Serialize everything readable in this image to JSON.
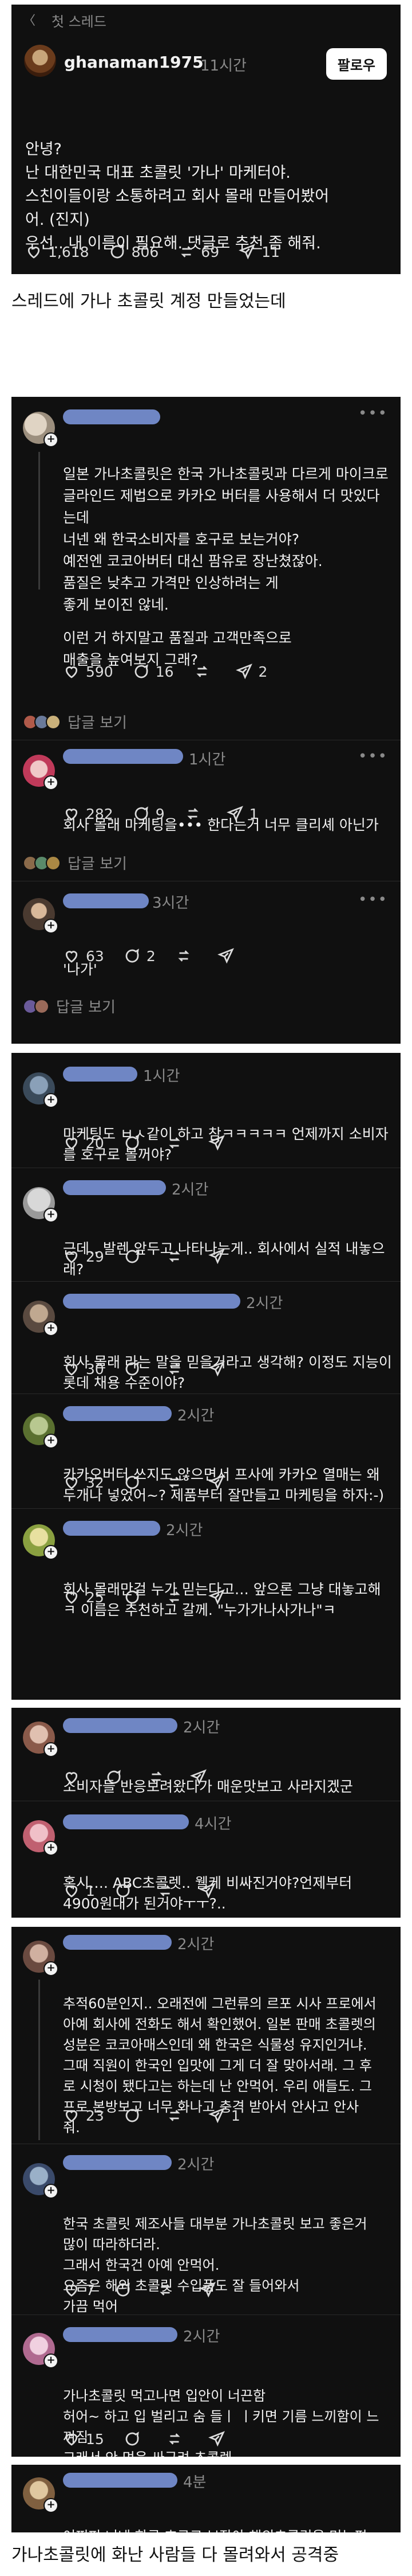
{
  "header": {
    "back_label": "〈",
    "title": "첫 스레드"
  },
  "post": {
    "username": "ghanaman1975",
    "time": "11시간",
    "follow_label": "팔로우",
    "lines": [
      "안녕?",
      "난 대한민국 대표 초콜릿 '가나' 마케터야.",
      "스친이들이랑 소통하려고 회사 몰래 만들어봤어",
      "어. (진지)",
      "우선.. 내 이름이 필요해. 댓글로 추천 좀 해줘."
    ],
    "likes": "1,618",
    "comments": "806",
    "reposts": "69",
    "shares": "11"
  },
  "caption1": "스레드에 가나 초콜릿 계정 만들었는데",
  "card2": {
    "c1": {
      "time": "",
      "lines": [
        "일본 가나초콜릿은 한국 가나초콜릿과 다르게 마이크로",
        "글라인드 제법으로 카카오 버터를 사용해서 더 맛있다",
        "는데",
        "너넨 왜 한국소비자를 호구로 보는거야?",
        "예전엔 코코아버터 대신 팜유로 장난쳤잖아.",
        "품질은 낮추고 가격만 인상하려는 게",
        "좋게 보이진 않네.",
        "",
        "이런 거 하지말고 품질과 고객만족으로",
        "매출을 높여보지 그래?"
      ],
      "likes": "590",
      "comments": "16",
      "reposts": "",
      "shares": "2",
      "replies": "답글 보기"
    },
    "c2": {
      "time": "1시간",
      "lines": [
        "회사 몰래 마케팅을••• 한다는거 너무 클리셰 아닌가"
      ],
      "likes": "282",
      "comments": "9",
      "reposts": "",
      "shares": "1",
      "replies": "답글 보기"
    },
    "c3": {
      "time": "3시간",
      "lines": [
        "'나가'"
      ],
      "likes": "63",
      "comments": "2",
      "reposts": "",
      "shares": "",
      "replies": "답글 보기"
    }
  },
  "card3": {
    "c1": {
      "time": "1시간",
      "lines": [
        "마케팅도 ㅂㅅ같이 하고 참ㅋㅋㅋㅋㅋ 언제까지 소비자",
        "를 호구로 볼꺼야?"
      ],
      "likes": "20",
      "comments": "",
      "reposts": "",
      "shares": ""
    },
    "c2": {
      "time": "2시간",
      "lines": [
        "근데.. 발렌 앞두고 나타나는게.. 회사에서 실적 내놓으",
        "래?"
      ],
      "likes": "29",
      "comments": "",
      "reposts": "",
      "shares": ""
    },
    "c3": {
      "time": "2시간",
      "lines": [
        "회사 몰래 라는 말을 믿을거라고 생각해? 이정도 지능이",
        "롯데 채용 수준이야?"
      ],
      "likes": "30",
      "comments": "",
      "reposts": "",
      "shares": ""
    },
    "c4": {
      "time": "2시간",
      "lines": [
        "카카오버터 쓰지도 않으면서 프사에 카카오 열매는 왜",
        "두개나 넣었어~? 제품부터 잘만들고 마케팅을 하자:-)"
      ],
      "likes": "32",
      "comments": "",
      "reposts": "",
      "shares": ""
    },
    "c5": {
      "time": "2시간",
      "lines": [
        "회사 몰래만걸 누가 믿는다고… 앞으론 그냥 대놓고해",
        "ㅋ 이름은 추천하고 갈께. \"누가가나사가나\"ㅋ"
      ],
      "likes": "25",
      "comments": "",
      "reposts": "",
      "shares": ""
    }
  },
  "card4": {
    "c1": {
      "time": "2시간",
      "lines": [
        "소비자들 반응보려왔다가 매운맛보고 사라지겠군"
      ],
      "likes": "",
      "comments": "",
      "reposts": "",
      "shares": ""
    },
    "c2": {
      "time": "4시간",
      "lines": [
        "혹시…. ABC초콜렛.. 웰케 비싸진거야?언제부터",
        "4900원대가 된거야ㅜㅜ?.."
      ],
      "likes": "1",
      "comments": "",
      "reposts": "",
      "shares": ""
    }
  },
  "card5": {
    "c1": {
      "time": "2시간",
      "lines": [
        "추적60분인지.. 오래전에 그런류의 르포 시사 프로에서",
        "아예 회사에 전화도 해서 확인했어. 일본 판매 초콜렛의",
        "성분은 코코아매스인데 왜 한국은 식물성 유지인거냐.",
        "그때 직원이 한국인 입맛에 그게 더 잘 맞아서래. 그 후",
        "로 시청이 됐다고는 하는데 난 안먹어. 우리 애들도. 그",
        "프로 본방보고 너무 화나고 충격 받아서 안사고 안사",
        "줘."
      ],
      "likes": "23",
      "comments": "",
      "reposts": "",
      "shares": "1"
    },
    "c2": {
      "time": "2시간",
      "lines": [
        "한국 초콜릿 제조사들 대부분 가나초콜릿 보고 좋은거",
        "많이 따라하더라.",
        "그래서 한국건 아예 안먹어.",
        "요즘은 해외 초콜릿 수입품도 잘 들어와서",
        "가끔 먹어"
      ],
      "likes": "7",
      "comments": "",
      "reposts": "",
      "shares": ""
    },
    "c3": {
      "time": "2시간",
      "lines": [
        "가나초콜릿 먹고나면 입안이 너끈함",
        "허어~ 하고 입 벌리고 숨 들ㅣ ㅣ키면 기름 느끼함이 느",
        "껴짐",
        "그래서 안 먹음 싸구려 초콜렛"
      ],
      "likes": "15",
      "comments": "",
      "reposts": "",
      "shares": ""
    }
  },
  "card6": {
    "c1": {
      "time": "4분",
      "lines": [
        "어쩌피 너네 한국 호구로 보잖아 해외초콜릿을 먹는편",
        "이야"
      ]
    }
  },
  "caption2": "가나초콜릿에 화난 사람들 다 몰려와서 공격중",
  "icons": {
    "heart": "heart-icon",
    "comment": "comment-icon",
    "repost": "repost-icon",
    "share": "share-icon",
    "more": "more-icon"
  },
  "colors": {
    "card_bg": "#101010",
    "redaction": "#6f86c4",
    "muted": "#8a8a8a"
  }
}
